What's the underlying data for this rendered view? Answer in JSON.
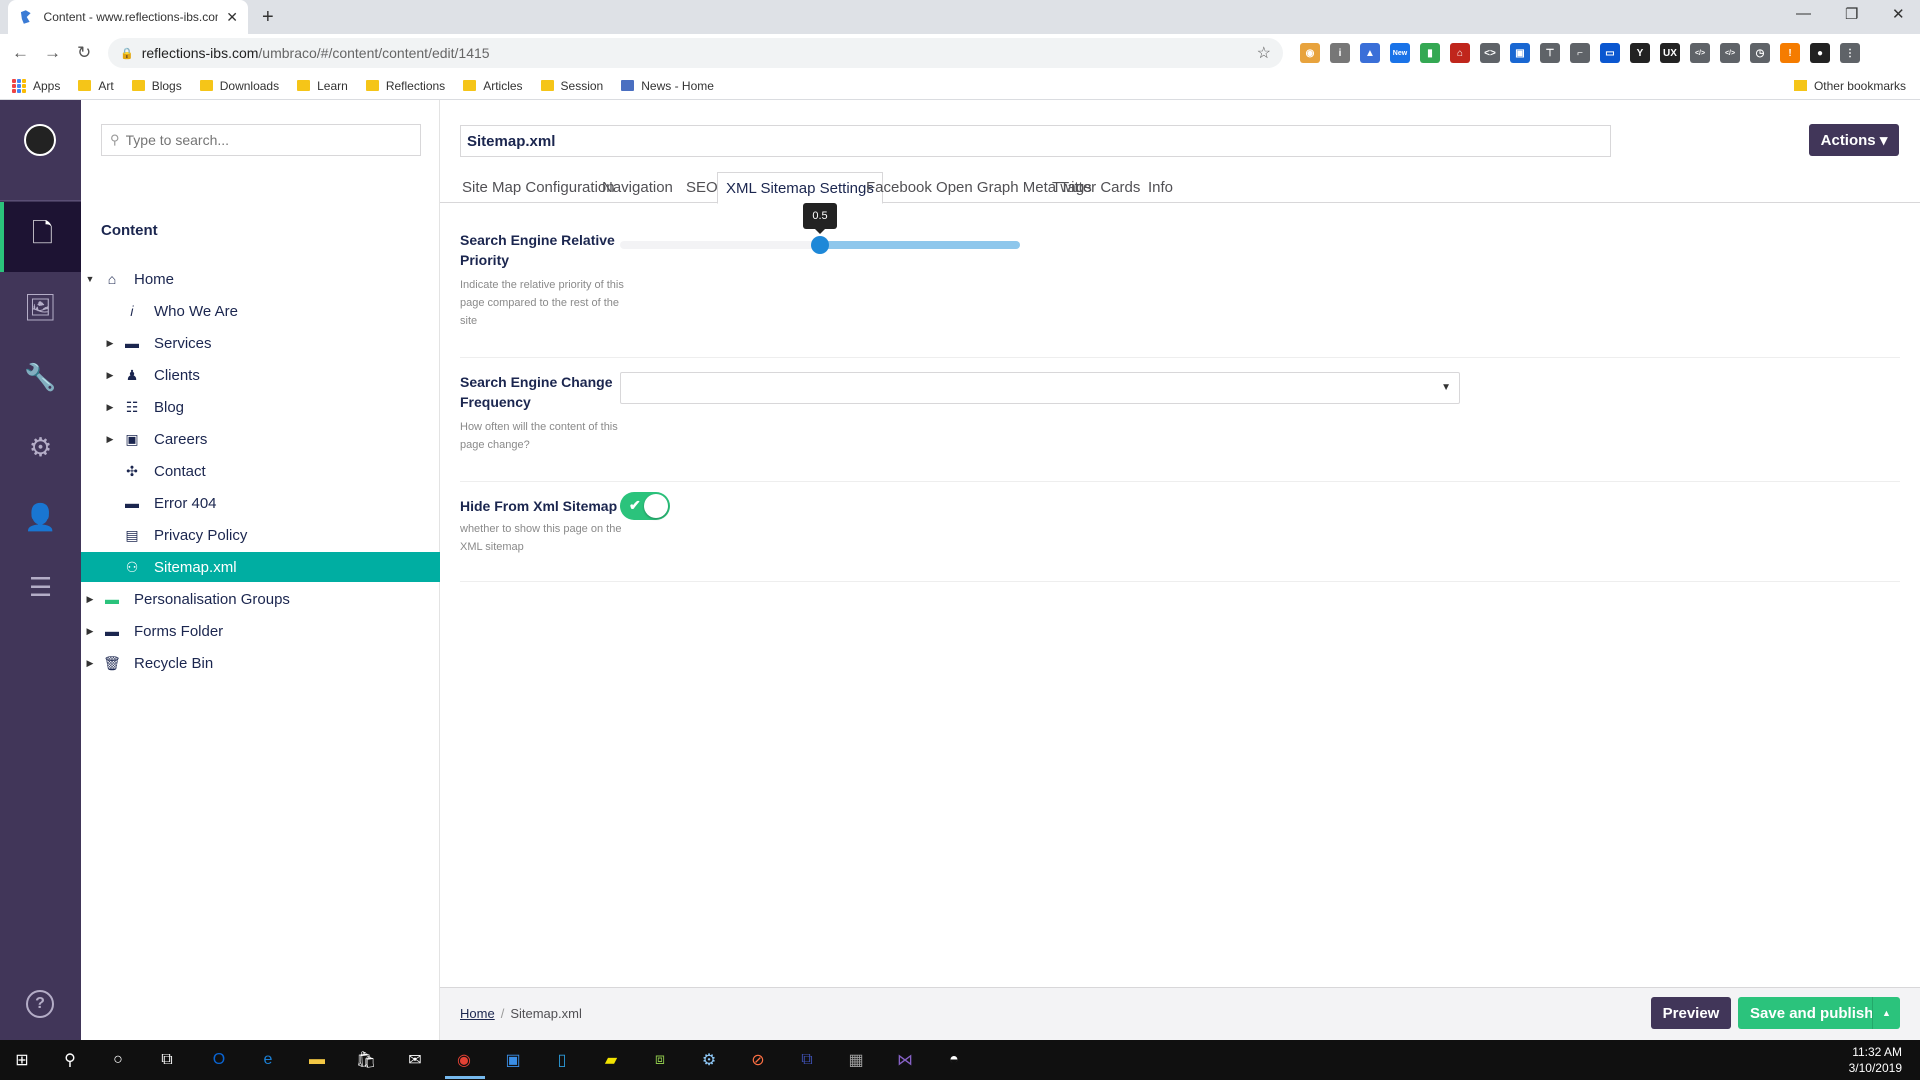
{
  "browser": {
    "tab_title": "Content - www.reflections-ibs.com",
    "tab_close": "✕",
    "new_tab": "+",
    "url_host": "reflections-ibs.com",
    "url_path": "/umbraco/#/content/content/edit/1415",
    "window_controls": {
      "minimize": "—",
      "restore": "❐",
      "close": "✕"
    },
    "bookmarks": [
      "Apps",
      "Art",
      "Blogs",
      "Downloads",
      "Learn",
      "Reflections",
      "Articles",
      "Session",
      "News - Home"
    ],
    "other_bookmarks": "Other bookmarks",
    "extensions": [
      {
        "icon": "pocket-icon",
        "color": "#e8a33d",
        "label": "◉"
      },
      {
        "icon": "info-icon",
        "color": "#777777",
        "label": "i"
      },
      {
        "icon": "user-icon",
        "color": "#3a6fd8",
        "label": "▲"
      },
      {
        "icon": "new-badge-icon",
        "color": "#1a73e8",
        "label": "New"
      },
      {
        "icon": "chart-icon",
        "color": "#34a853",
        "label": "▮"
      },
      {
        "icon": "pdf-icon",
        "color": "#c0261c",
        "label": "⌂"
      },
      {
        "icon": "code-icon",
        "color": "#5f6368",
        "label": "<>"
      },
      {
        "icon": "screen-icon",
        "color": "#1967d2",
        "label": "▣"
      },
      {
        "icon": "pin-icon",
        "color": "#5f6368",
        "label": "⊤"
      },
      {
        "icon": "ruler-icon",
        "color": "#5f6368",
        "label": "⌐"
      },
      {
        "icon": "window-icon",
        "color": "#0b57d0",
        "label": "▭"
      },
      {
        "icon": "y-icon",
        "color": "#222222",
        "label": "Y"
      },
      {
        "icon": "ux-icon",
        "color": "#222222",
        "label": "UX"
      },
      {
        "icon": "tag-icon",
        "color": "#5f6368",
        "label": "</>"
      },
      {
        "icon": "code2-icon",
        "color": "#5f6368",
        "label": "</>"
      },
      {
        "icon": "clock-icon",
        "color": "#5f6368",
        "label": "◷"
      },
      {
        "icon": "orange-icon",
        "color": "#f57c00",
        "label": "!"
      },
      {
        "icon": "profile-icon",
        "color": "#222222",
        "label": "●"
      },
      {
        "icon": "menu-icon",
        "color": "#5f6368",
        "label": "⋮"
      }
    ]
  },
  "colors": {
    "umbraco_nav": "#413659",
    "tree_active": "#00aea2",
    "success": "#2bc37c",
    "slider_handle": "#1e88d8"
  },
  "leftnav": {
    "sections": [
      {
        "name": "content-section-icon",
        "glyph": "🗋"
      },
      {
        "name": "media-section-icon",
        "glyph": "🖼"
      },
      {
        "name": "settings-wrench-icon",
        "glyph": "🔧"
      },
      {
        "name": "settings-gear-icon",
        "glyph": "⚙"
      },
      {
        "name": "members-icon",
        "glyph": "👤"
      },
      {
        "name": "forms-icon",
        "glyph": "☰"
      }
    ],
    "help": "?"
  },
  "tree": {
    "search_placeholder": "Type to search...",
    "heading": "Content",
    "nodes": [
      {
        "label": "Home",
        "icon": "⌂",
        "caret": "▼"
      },
      {
        "label": "Who We Are",
        "icon": "𝑖",
        "caret": ""
      },
      {
        "label": "Services",
        "icon": "▬",
        "caret": "▶"
      },
      {
        "label": "Clients",
        "icon": "♟",
        "caret": "▶"
      },
      {
        "label": "Blog",
        "icon": "☷",
        "caret": "▶"
      },
      {
        "label": "Careers",
        "icon": "▣",
        "caret": "▶"
      },
      {
        "label": "Contact",
        "icon": "✣",
        "caret": ""
      },
      {
        "label": "Error 404",
        "icon": "▬",
        "caret": ""
      },
      {
        "label": "Privacy Policy",
        "icon": "▤",
        "caret": ""
      },
      {
        "label": "Sitemap.xml",
        "icon": "⚇",
        "caret": ""
      },
      {
        "label": "Personalisation Groups",
        "icon": "▬",
        "caret": "▶"
      },
      {
        "label": "Forms Folder",
        "icon": "▬",
        "caret": "▶"
      },
      {
        "label": "Recycle Bin",
        "icon": "🗑",
        "caret": "▶"
      }
    ]
  },
  "editor": {
    "name": "Sitemap.xml",
    "actions_label": "Actions ▾",
    "tabs": [
      "Site Map Configuration",
      "Navigation",
      "SEO",
      "XML Sitemap Settings",
      "Facebook Open Graph Meta Tags",
      "Twitter Cards",
      "Info"
    ],
    "active_tab": "XML Sitemap Settings",
    "properties": {
      "priority": {
        "label": "Search Engine Relative Priority",
        "description": "Indicate the relative priority of this page compared to the rest of the site",
        "value": 0.5,
        "value_text": "0.5",
        "min": 0,
        "max": 1,
        "fill_start": 0.5,
        "fill_end": 1.0
      },
      "frequency": {
        "label": "Search Engine Change Frequency",
        "description": "How often will the content of this page change?",
        "value": "",
        "arrow": "▼"
      },
      "hide": {
        "label": "Hide From Xml Sitemap",
        "description": "whether to show this page on the XML sitemap",
        "value": true,
        "check": "✔"
      }
    },
    "breadcrumb": [
      "Home",
      "Sitemap.xml"
    ],
    "preview_label": "Preview",
    "publish_label": "Save and publish",
    "publish_caret": "▲"
  },
  "taskbar": {
    "icons": [
      {
        "name": "windows-start-icon",
        "glyph": "⊞",
        "color": "#ffffff"
      },
      {
        "name": "search-icon",
        "glyph": "⚲",
        "color": "#ffffff"
      },
      {
        "name": "cortana-icon",
        "glyph": "○",
        "color": "#ffffff"
      },
      {
        "name": "task-view-icon",
        "glyph": "⧉",
        "color": "#ffffff"
      },
      {
        "name": "outlook-icon",
        "glyph": "O",
        "color": "#0a64d2"
      },
      {
        "name": "edge-icon",
        "glyph": "e",
        "color": "#1b7fd4"
      },
      {
        "name": "file-explorer-icon",
        "glyph": "▬",
        "color": "#f3c744"
      },
      {
        "name": "store-icon",
        "glyph": "🛍",
        "color": "#ffffff"
      },
      {
        "name": "mail-icon",
        "glyph": "✉",
        "color": "#ffffff"
      },
      {
        "name": "chrome-icon",
        "glyph": "◉",
        "color": "#e44134"
      },
      {
        "name": "remote-desktop-icon",
        "glyph": "▣",
        "color": "#3a8ee6"
      },
      {
        "name": "phone-icon",
        "glyph": "▯",
        "color": "#2d9cdb"
      },
      {
        "name": "sticky-notes-icon",
        "glyph": "▰",
        "color": "#f2e300"
      },
      {
        "name": "network-icon",
        "glyph": "⧈",
        "color": "#8bc34a"
      },
      {
        "name": "settings-app-icon",
        "glyph": "⚙",
        "color": "#90caf9"
      },
      {
        "name": "orange-app-icon",
        "glyph": "⊘",
        "color": "#ff7043"
      },
      {
        "name": "network2-icon",
        "glyph": "⧉",
        "color": "#3f51b5"
      },
      {
        "name": "webcam-icon",
        "glyph": "▦",
        "color": "#9e9e9e"
      },
      {
        "name": "visual-studio-icon",
        "glyph": "⋈",
        "color": "#8661c5"
      },
      {
        "name": "octo-icon",
        "glyph": "◓",
        "color": "#ffffff"
      }
    ],
    "time": "11:32 AM",
    "date": "3/10/2019"
  }
}
